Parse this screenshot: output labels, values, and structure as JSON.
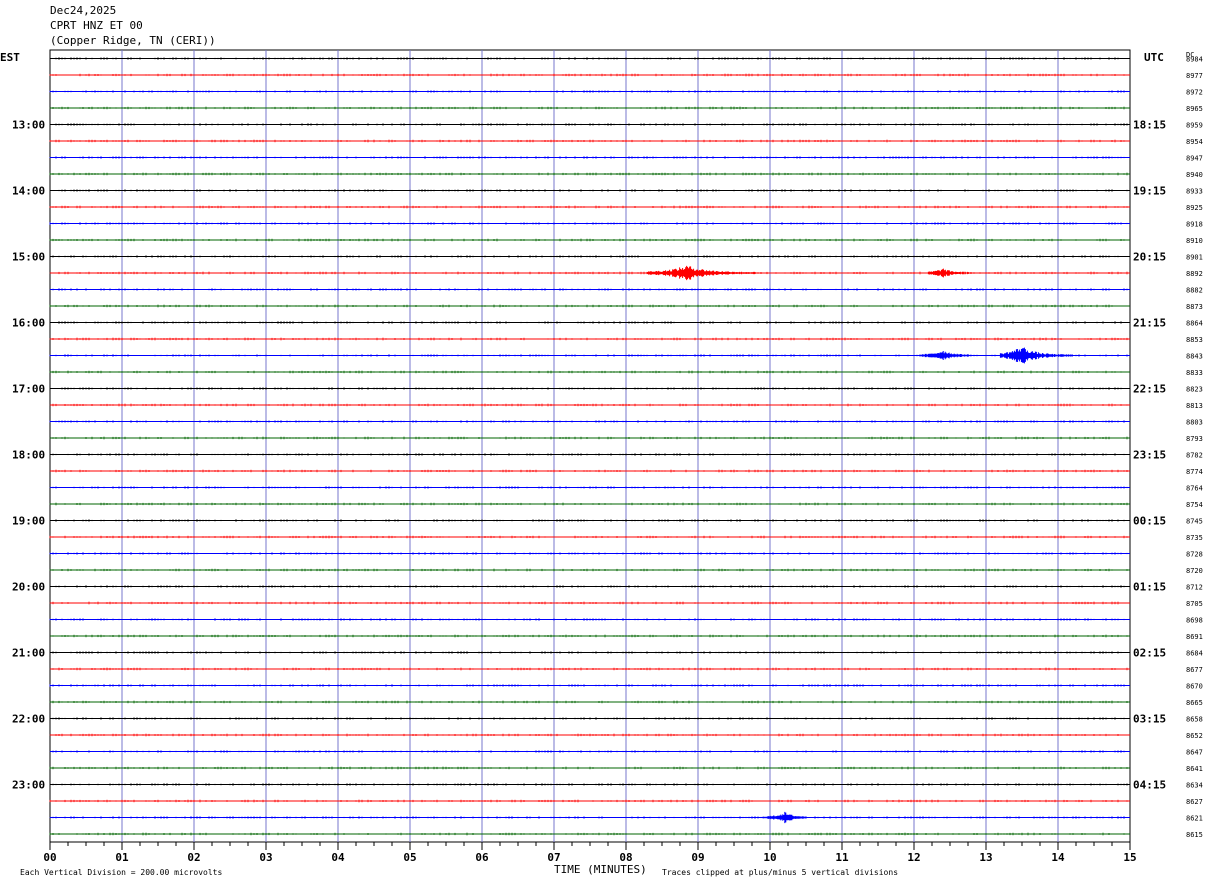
{
  "header": {
    "date": "Dec24,2025",
    "station": "CPRT HNZ ET 00",
    "location": "(Copper Ridge, TN (CERI))"
  },
  "labels": {
    "left_tz": "EST",
    "right_tz": "UTC",
    "dc": "DC",
    "xlabel": "TIME (MINUTES)",
    "scale_note": "Each Vertical Division =  200.00 microvolts",
    "clip_note": "Traces clipped at plus/minus 5 vertical divisions"
  },
  "chart_data": {
    "type": "line",
    "title": "",
    "xlabel": "TIME (MINUTES)",
    "x_range": [
      0,
      15
    ],
    "x_ticks": [
      "00",
      "01",
      "02",
      "03",
      "04",
      "05",
      "06",
      "07",
      "08",
      "09",
      "10",
      "11",
      "12",
      "13",
      "14",
      "15"
    ],
    "rows_count": 48,
    "minutes_per_row": 15,
    "start_row_est": "12:00",
    "colors": {
      "cycle": [
        "#000000",
        "#ff0000",
        "#0000ff",
        "#006400"
      ],
      "grid_vertical": "#7777cc"
    },
    "left_hour_labels": [
      {
        "row": 4,
        "label": "13:00"
      },
      {
        "row": 8,
        "label": "14:00"
      },
      {
        "row": 12,
        "label": "15:00"
      },
      {
        "row": 16,
        "label": "16:00"
      },
      {
        "row": 20,
        "label": "17:00"
      },
      {
        "row": 24,
        "label": "18:00"
      },
      {
        "row": 28,
        "label": "19:00"
      },
      {
        "row": 32,
        "label": "20:00"
      },
      {
        "row": 36,
        "label": "21:00"
      },
      {
        "row": 40,
        "label": "22:00"
      },
      {
        "row": 44,
        "label": "23:00"
      }
    ],
    "right_hour_labels": [
      {
        "row": 4,
        "label": "18:15"
      },
      {
        "row": 8,
        "label": "19:15"
      },
      {
        "row": 12,
        "label": "20:15"
      },
      {
        "row": 16,
        "label": "21:15"
      },
      {
        "row": 20,
        "label": "22:15"
      },
      {
        "row": 24,
        "label": "23:15"
      },
      {
        "row": 28,
        "label": "00:15"
      },
      {
        "row": 32,
        "label": "01:15"
      },
      {
        "row": 36,
        "label": "02:15"
      },
      {
        "row": 40,
        "label": "03:15"
      },
      {
        "row": 44,
        "label": "04:15"
      }
    ],
    "dc_values": [
      "8984",
      "8977",
      "8972",
      "8965",
      "8959",
      "8954",
      "8947",
      "8940",
      "8933",
      "8925",
      "8918",
      "8910",
      "8901",
      "8892",
      "8882",
      "8873",
      "8864",
      "8853",
      "8843",
      "8833",
      "8823",
      "8813",
      "8803",
      "8793",
      "8782",
      "8774",
      "8764",
      "8754",
      "8745",
      "8735",
      "8728",
      "8720",
      "8712",
      "8705",
      "8698",
      "8691",
      "8684",
      "8677",
      "8670",
      "8665",
      "8658",
      "8652",
      "8647",
      "8641",
      "8634",
      "8627",
      "8621",
      "8615"
    ],
    "events": [
      {
        "row": 13,
        "start_min": 8.3,
        "end_min": 9.8,
        "peak_min": 8.85,
        "amplitude": 7
      },
      {
        "row": 13,
        "start_min": 12.2,
        "end_min": 12.8,
        "peak_min": 12.4,
        "amplitude": 4
      },
      {
        "row": 18,
        "start_min": 12.1,
        "end_min": 12.8,
        "peak_min": 12.4,
        "amplitude": 5
      },
      {
        "row": 18,
        "start_min": 13.2,
        "end_min": 14.2,
        "peak_min": 13.5,
        "amplitude": 9
      },
      {
        "row": 46,
        "start_min": 9.9,
        "end_min": 10.5,
        "peak_min": 10.2,
        "amplitude": 5
      }
    ]
  }
}
